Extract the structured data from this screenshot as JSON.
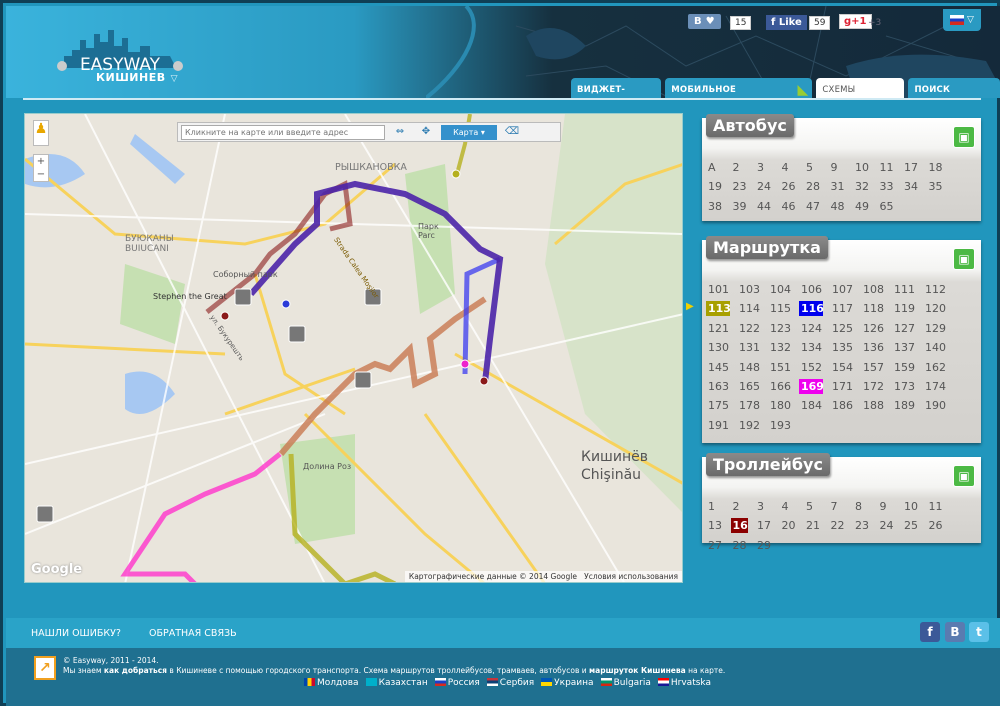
{
  "header": {
    "logo_text": "EASYWAY",
    "city": "КИШИНЕВ",
    "vk_label": "В",
    "vk_count": "15",
    "fb_label": "Like",
    "fb_count": "59",
    "gplus_label": "g+1",
    "gplus_count": "+3"
  },
  "tabs": [
    {
      "label": "ВИДЖЕТ-СИСТЕМА"
    },
    {
      "label": "МОБИЛЬНОЕ ПРИЛОЖЕНИЕ"
    },
    {
      "label": "СХЕМЫ МАРШРУТОВ"
    },
    {
      "label": "ПОИСК МАРШРУТА"
    }
  ],
  "map": {
    "search_placeholder": "Кликните на карте или введите адрес",
    "type_label": "Карта",
    "attribution": "Картографические данные © 2014 Google",
    "terms": "Условия использования",
    "google": "Google",
    "labels": [
      "РЫШКАНОВКА",
      "БУЮКАНЫ BUIUCANI",
      "Парк Parc",
      "Соборный парк",
      "Stephen the Great",
      "Долина Роз",
      "Кишинёв",
      "Chişinău",
      "Strada Calea Moşilor",
      "ул. Букурешть"
    ],
    "route_colors": {
      "r113": "#b5b01e",
      "r116": "#3b3bf0",
      "r169": "#ff33cc",
      "r16": "#8b1a1a",
      "overlap": "#4b23a8",
      "orange": "#c87850"
    }
  },
  "panels": {
    "bus": {
      "title": "Автобус",
      "routes": [
        "A",
        "2",
        "3",
        "4",
        "5",
        "9",
        "10",
        "11",
        "17",
        "18",
        "19",
        "23",
        "24",
        "26",
        "28",
        "31",
        "32",
        "33",
        "34",
        "35",
        "38",
        "39",
        "44",
        "46",
        "47",
        "48",
        "49",
        "65"
      ]
    },
    "minibus": {
      "title": "Маршрутка",
      "routes": [
        "101",
        "103",
        "104",
        "106",
        "107",
        "108",
        "111",
        "112",
        "113",
        "114",
        "115",
        "116",
        "117",
        "118",
        "119",
        "120",
        "121",
        "122",
        "123",
        "124",
        "125",
        "126",
        "127",
        "129",
        "130",
        "131",
        "132",
        "134",
        "135",
        "136",
        "137",
        "140",
        "145",
        "148",
        "151",
        "152",
        "154",
        "157",
        "159",
        "162",
        "163",
        "165",
        "166",
        "169",
        "171",
        "172",
        "173",
        "174",
        "175",
        "178",
        "180",
        "184",
        "186",
        "188",
        "189",
        "190",
        "191",
        "192",
        "193"
      ],
      "selected": {
        "113": "#a8a000",
        "116": "#0000ee",
        "169": "#ee00ee"
      }
    },
    "trolleybus": {
      "title": "Троллейбус",
      "routes": [
        "1",
        "2",
        "3",
        "4",
        "5",
        "7",
        "8",
        "9",
        "10",
        "11",
        "13",
        "16",
        "17",
        "20",
        "21",
        "22",
        "23",
        "24",
        "25",
        "26",
        "27",
        "28",
        "29"
      ],
      "selected": {
        "16": "#8b0000"
      }
    }
  },
  "footer": {
    "report": "НАШЛИ ОШИБКУ?",
    "feedback": "ОБРАТНАЯ СВЯЗЬ",
    "copyright": "© Easyway, 2011 - 2014.",
    "desc_1": "Мы знаем ",
    "desc_b1": "как добраться",
    "desc_2": " в Кишиневе с помощью городского транспорта. Схема маршрутов троллейбусов, трамваев, автобусов и ",
    "desc_b2": "маршруток Кишинева",
    "desc_3": " на карте.",
    "languages": [
      "Молдова",
      "Казахстан",
      "Россия",
      "Сербия",
      "Украина",
      "Bulgaria",
      "Hrvatska"
    ]
  }
}
